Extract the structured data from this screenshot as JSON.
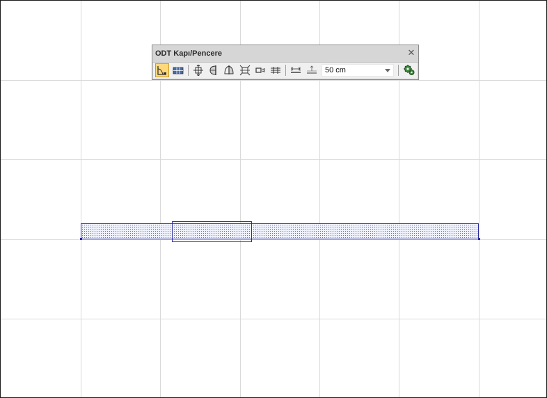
{
  "toolbar": {
    "title": "ODT Kapı/Pencere",
    "close_glyph": "✕",
    "buttons": [
      {
        "icon": "door-swing-icon",
        "active": true
      },
      {
        "icon": "window-grid-icon",
        "active": false
      },
      {
        "icon": "move-opening-icon",
        "active": false
      },
      {
        "icon": "flip-side-icon",
        "active": false
      },
      {
        "icon": "mirror-opening-icon",
        "active": false
      },
      {
        "icon": "fit-opening-icon",
        "active": false
      },
      {
        "icon": "dimension-offset-icon",
        "active": false
      },
      {
        "icon": "multi-line-icon",
        "active": false
      },
      {
        "icon": "measure-width-icon",
        "active": false
      },
      {
        "icon": "measure-height-icon",
        "active": false
      },
      {
        "icon": "settings-gear-icon",
        "active": false
      }
    ],
    "offset_select": {
      "value": "50 cm"
    }
  },
  "colors": {
    "wall_stroke": "#2b2b9c",
    "grid": "#d9d9d9",
    "active_button": "#ffd87a"
  }
}
